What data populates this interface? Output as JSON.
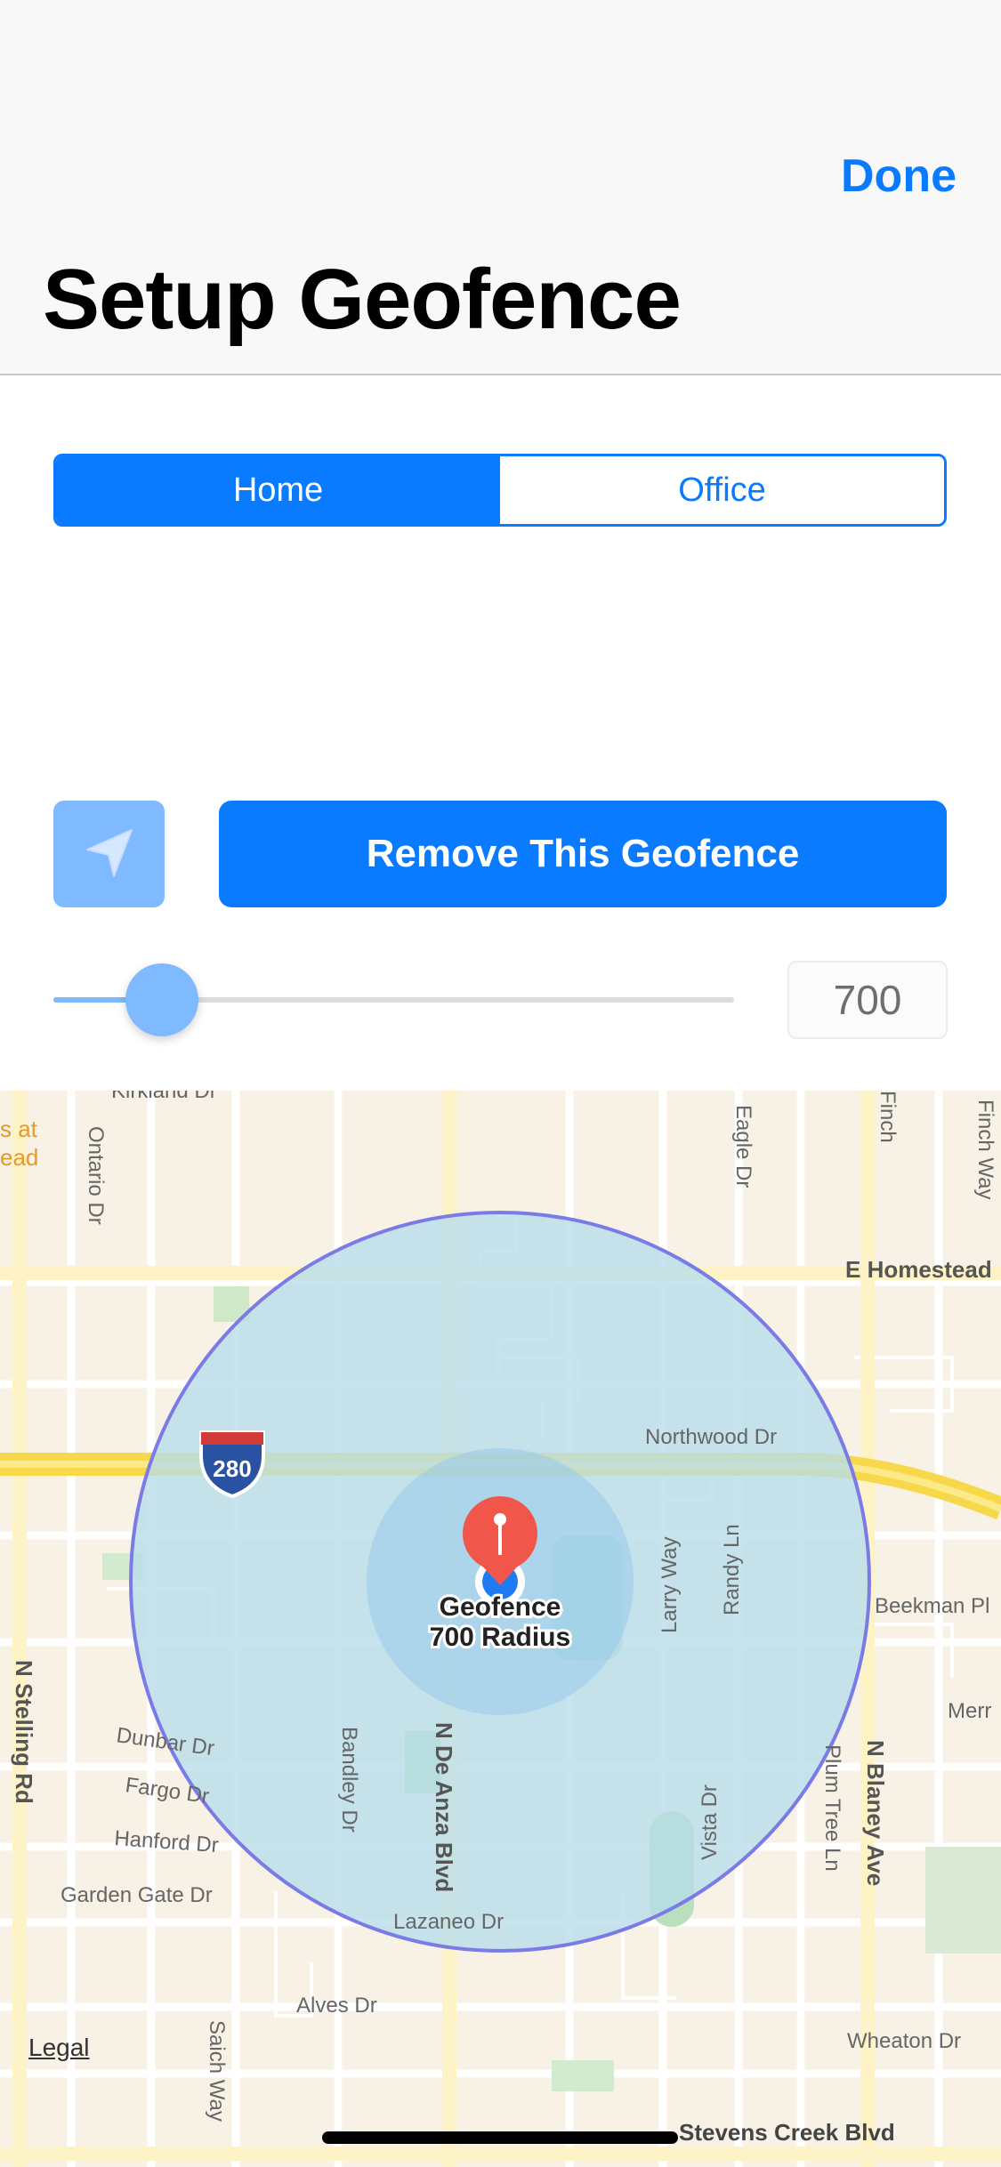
{
  "nav": {
    "done_label": "Done",
    "title": "Setup Geofence"
  },
  "segment": {
    "items": [
      {
        "label": "Home",
        "selected": true
      },
      {
        "label": "Office",
        "selected": false
      }
    ]
  },
  "controls": {
    "remove_label": "Remove This Geofence",
    "location_icon": "location-arrow-icon",
    "radius_value": "700",
    "slider_fraction": 0.16
  },
  "map": {
    "legal": "Legal",
    "pin_label_line1": "Geofence",
    "pin_label_line2": "700 Radius",
    "highway_shield": "280",
    "streets": {
      "kirkland": "Kirkland Dr",
      "ontario": "Ontario Dr",
      "eagle": "Eagle Dr",
      "finch": "Finch",
      "finch_way": "Finch Way",
      "homestead_left": "s at",
      "homestead_left2": "ead",
      "homestead": "E Homestead",
      "northwood": "Northwood Dr",
      "larry": "Larry Way",
      "randy": "Randy Ln",
      "beekman": "Beekman Pl",
      "merr": "Merr",
      "stelling": "N Stelling Rd",
      "dunbar": "Dunbar Dr",
      "fargo": "Fargo Dr",
      "hanford": "Hanford Dr",
      "garden_gate": "Garden Gate Dr",
      "bandley": "Bandley Dr",
      "de_anza": "N De Anza Blvd",
      "lazaneo": "Lazaneo Dr",
      "vista": "Vista Dr",
      "plum_tree": "Plum Tree Ln",
      "blaney": "N Blaney Ave",
      "alves": "Alves Dr",
      "saich": "Saich Way",
      "wheaton": "Wheaton Dr",
      "stevens_creek": "Stevens Creek Blvd"
    },
    "colors": {
      "circle_fill": "#b7dde9",
      "circle_stroke": "#7b7be8",
      "pin": "#f0564a",
      "user_dot": "#1e7bf2",
      "highway": "#f7d84a"
    }
  }
}
